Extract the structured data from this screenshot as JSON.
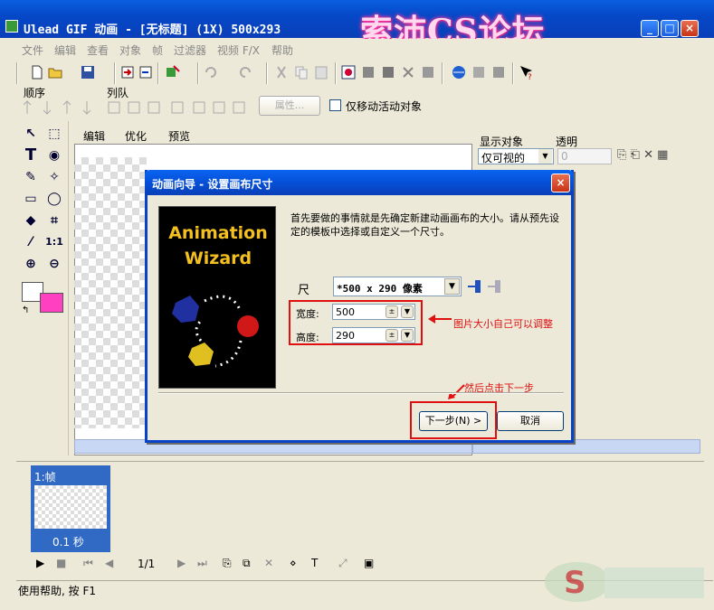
{
  "window": {
    "title": "Ulead GIF 动画 - [无标题] (1X) 500x293",
    "watermark": "索沛CS论坛",
    "minimize": "_",
    "maximize": "□",
    "close": "×"
  },
  "menu": [
    "文件",
    "编辑",
    "查看",
    "对象",
    "帧",
    "过滤器",
    "视频 F/X",
    "帮助"
  ],
  "toolbar2": {
    "order_label": "顺序",
    "queue_label": "列队",
    "properties_button": "属性...",
    "move_active_only_label": "仅移动活动对象"
  },
  "tabs": [
    "编辑",
    "优化",
    "预览"
  ],
  "right_panel": {
    "display_label": "显示对象",
    "transparency_label": "透明",
    "display_value": "仅可视的",
    "transparency_value": "0"
  },
  "frame": {
    "label": "1:帧",
    "delay": "0.1 秒"
  },
  "playback": {
    "page": "1/1"
  },
  "status": "使用帮助, 按 F1",
  "dialog": {
    "title": "动画向导 - 设置画布尺寸",
    "close": "×",
    "wizard_line1": "Animation",
    "wizard_line2": "Wizard",
    "description": "首先要做的事情就是先确定新建动画画布的大小。请从预先设定的模板中选择或自定义一个尺寸。",
    "size_label": "尺",
    "size_value": "*500 x 290 像素",
    "width_label": "宽度:",
    "width_value": "500",
    "height_label": "高度:",
    "height_value": "290",
    "annotation_adjust": "图片大小自己可以调整",
    "annotation_next": "然后点击下一步",
    "next_button": "下一步(N) >",
    "cancel_button": "取消"
  },
  "colors": {
    "fg_swatch": "#ffffff",
    "bg_swatch": "#ff40c0",
    "annotation": "#e01010"
  }
}
